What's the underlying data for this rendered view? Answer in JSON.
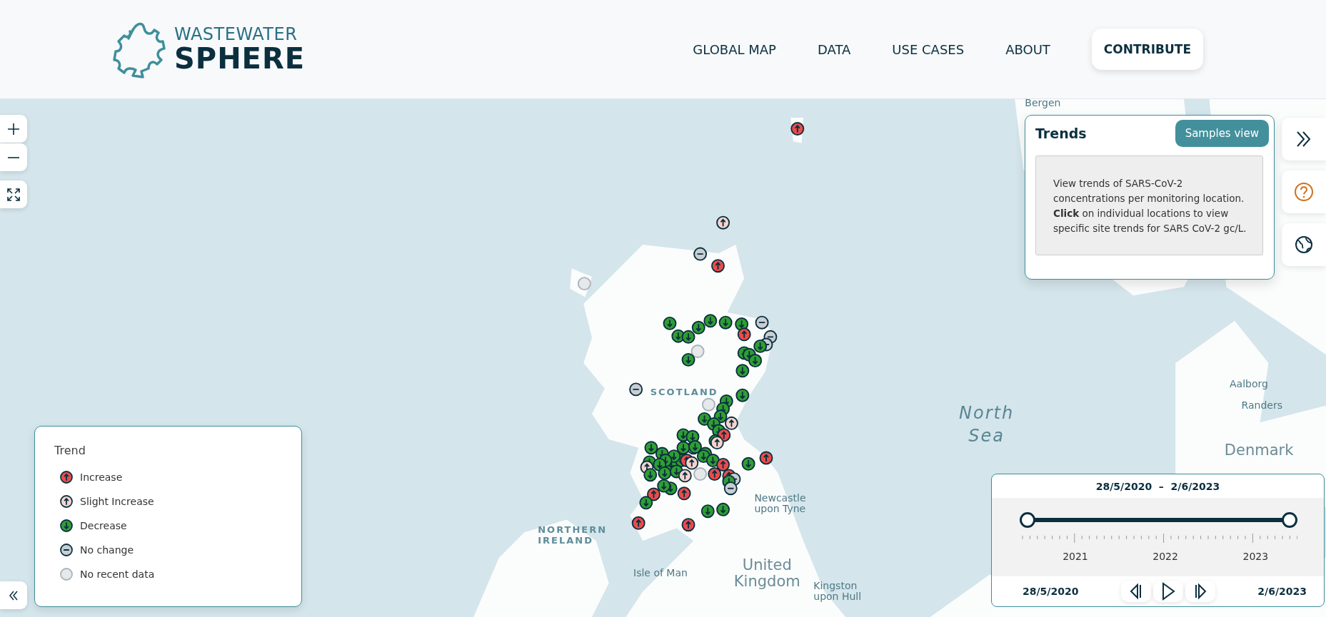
{
  "header": {
    "logo": {
      "line1": "WASTEWATER",
      "line2": "SPHERE"
    },
    "nav": [
      {
        "label": "GLOBAL MAP",
        "kind": "link"
      },
      {
        "label": "DATA",
        "kind": "link"
      },
      {
        "label": "USE CASES",
        "kind": "link"
      },
      {
        "label": "ABOUT",
        "kind": "link"
      },
      {
        "label": "CONTRIBUTE",
        "kind": "button"
      }
    ]
  },
  "map": {
    "labels": [
      {
        "text": "Bergen",
        "kind": "city"
      },
      {
        "text": "Aalborg",
        "kind": "city"
      },
      {
        "text": "SCOTLAND",
        "kind": "region"
      },
      {
        "text": "Randers",
        "kind": "city"
      },
      {
        "text": "North Sea",
        "kind": "sea"
      },
      {
        "text": "Denmark",
        "kind": "country"
      },
      {
        "text": "Newcastle upon Tyne",
        "kind": "city"
      },
      {
        "text": "NORTHERN IRELAND",
        "kind": "region"
      },
      {
        "text": "Isle of Man",
        "kind": "city"
      },
      {
        "text": "United Kingdom",
        "kind": "country"
      },
      {
        "text": "Kingston upon Hull",
        "kind": "city"
      }
    ],
    "markers": [
      {
        "kind": "increase"
      },
      {
        "kind": "slight_increase"
      },
      {
        "kind": "no_change"
      },
      {
        "kind": "increase"
      },
      {
        "kind": "no_data"
      },
      {
        "kind": "decrease"
      },
      {
        "kind": "decrease"
      },
      {
        "kind": "decrease"
      },
      {
        "kind": "decrease"
      },
      {
        "kind": "decrease"
      },
      {
        "kind": "no_change"
      },
      {
        "kind": "increase"
      },
      {
        "kind": "decrease"
      },
      {
        "kind": "decrease"
      },
      {
        "kind": "no_data"
      },
      {
        "kind": "decrease"
      },
      {
        "kind": "no_change"
      },
      {
        "kind": "no_change"
      },
      {
        "kind": "decrease"
      },
      {
        "kind": "decrease"
      },
      {
        "kind": "decrease"
      },
      {
        "kind": "decrease"
      },
      {
        "kind": "decrease"
      },
      {
        "kind": "no_change"
      },
      {
        "kind": "decrease"
      },
      {
        "kind": "no_data"
      },
      {
        "kind": "decrease"
      },
      {
        "kind": "decrease"
      },
      {
        "kind": "decrease"
      },
      {
        "kind": "slight_increase"
      },
      {
        "kind": "decrease"
      },
      {
        "kind": "decrease"
      },
      {
        "kind": "decrease"
      },
      {
        "kind": "increase"
      },
      {
        "kind": "decrease"
      },
      {
        "kind": "decrease"
      },
      {
        "kind": "decrease"
      },
      {
        "kind": "slight_increase"
      },
      {
        "kind": "decrease"
      },
      {
        "kind": "decrease"
      },
      {
        "kind": "decrease"
      },
      {
        "kind": "slight_increase"
      },
      {
        "kind": "decrease"
      },
      {
        "kind": "decrease"
      },
      {
        "kind": "decrease"
      },
      {
        "kind": "decrease"
      },
      {
        "kind": "decrease"
      },
      {
        "kind": "decrease"
      },
      {
        "kind": "decrease"
      },
      {
        "kind": "slight_increase"
      },
      {
        "kind": "decrease"
      },
      {
        "kind": "decrease"
      },
      {
        "kind": "increase"
      },
      {
        "kind": "slight_increase"
      },
      {
        "kind": "decrease"
      },
      {
        "kind": "decrease"
      },
      {
        "kind": "no_data"
      },
      {
        "kind": "increase"
      },
      {
        "kind": "increase"
      },
      {
        "kind": "no_change"
      },
      {
        "kind": "decrease"
      },
      {
        "kind": "no_change"
      },
      {
        "kind": "increase"
      },
      {
        "kind": "decrease"
      },
      {
        "kind": "increase"
      },
      {
        "kind": "decrease"
      },
      {
        "kind": "decrease"
      },
      {
        "kind": "slight_increase"
      },
      {
        "kind": "decrease"
      },
      {
        "kind": "increase"
      },
      {
        "kind": "increase"
      },
      {
        "kind": "decrease"
      },
      {
        "kind": "decrease"
      },
      {
        "kind": "increase"
      },
      {
        "kind": "increase"
      },
      {
        "kind": "decrease"
      },
      {
        "kind": "decrease"
      }
    ]
  },
  "trends_panel": {
    "title": "Trends",
    "button": "Samples view",
    "info": "View trends of SARS-CoV-2 concentrations per monitoring location. **Click** on individual locations to view specific site trends for SARS CoV-2 gc/L."
  },
  "legend": {
    "title": "Trend",
    "items": [
      {
        "label": "Increase",
        "kind": "increase"
      },
      {
        "label": "Slight Increase",
        "kind": "slight_increase"
      },
      {
        "label": "Decrease",
        "kind": "decrease"
      },
      {
        "label": "No change",
        "kind": "no_change"
      },
      {
        "label": "No recent data",
        "kind": "no_data"
      }
    ]
  },
  "timeline": {
    "range": "28/5/2020  –  2/6/2023",
    "thumbs": [
      {
        "level": 0
      },
      {
        "level": 1
      }
    ],
    "years": [
      "2021",
      "2022",
      "2023"
    ],
    "start": "28/5/2020",
    "end": "2/6/2023"
  }
}
